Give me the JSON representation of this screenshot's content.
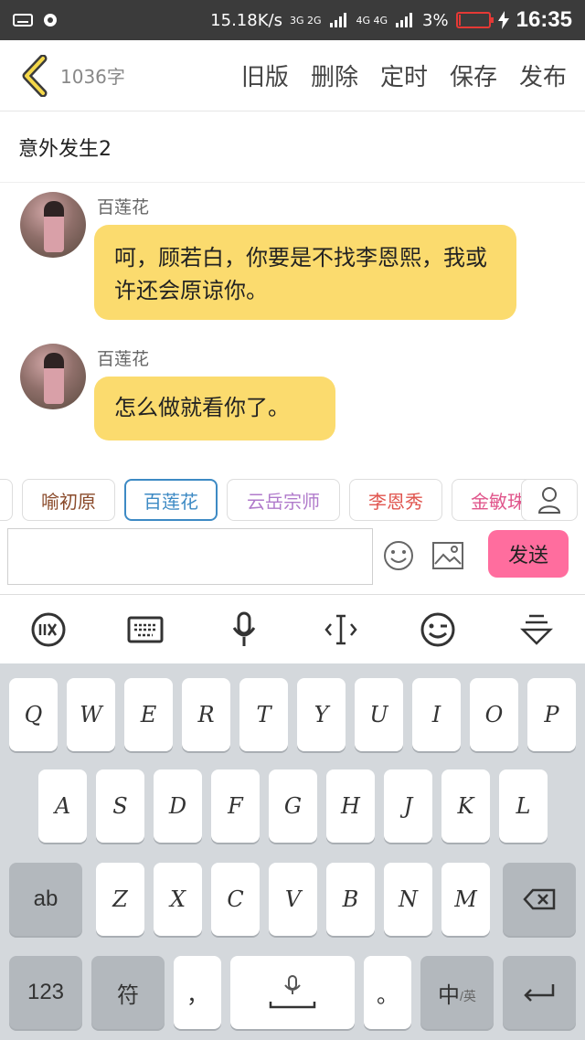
{
  "status": {
    "speed": "15.18K/s",
    "net1": "3G 2G",
    "net2": "4G 4G",
    "battery": "3%",
    "time": "16:35"
  },
  "header": {
    "word_count": "1036字",
    "actions": [
      "旧版",
      "删除",
      "定时",
      "保存",
      "发布"
    ]
  },
  "chapter_title": "意外发生2",
  "messages": [
    {
      "sender": "百莲花",
      "text": "呵，顾若白，你要是不找李恩熙，我或许还会原谅你。"
    },
    {
      "sender": "百莲花",
      "text": "怎么做就看你了。"
    }
  ],
  "chips": [
    {
      "label": "喻初原",
      "color": "#8a4a2a"
    },
    {
      "label": "百莲花",
      "color": "#3d8ac4"
    },
    {
      "label": "云岳宗师",
      "color": "#b07acb"
    },
    {
      "label": "李恩秀",
      "color": "#e0544e"
    },
    {
      "label": "金敏珠",
      "color": "#e0548a"
    }
  ],
  "send_label": "发送",
  "keyboard": {
    "row1": [
      "Q",
      "W",
      "E",
      "R",
      "T",
      "Y",
      "U",
      "I",
      "O",
      "P"
    ],
    "row2": [
      "A",
      "S",
      "D",
      "F",
      "G",
      "H",
      "J",
      "K",
      "L"
    ],
    "row3": [
      "Z",
      "X",
      "C",
      "V",
      "B",
      "N",
      "M"
    ],
    "ab": "ab",
    "num": "123",
    "sym": "符",
    "comma": "，",
    "period": "。",
    "lang_main": "中",
    "lang_sub": "/英"
  },
  "icons": [
    "back-chevron-icon",
    "person-icon",
    "emoji-icon",
    "image-icon",
    "ifly-icon",
    "keyboard-icon",
    "mic-icon",
    "cursor-icon",
    "wink-emoji-icon",
    "collapse-icon",
    "backspace-icon",
    "enter-icon"
  ]
}
